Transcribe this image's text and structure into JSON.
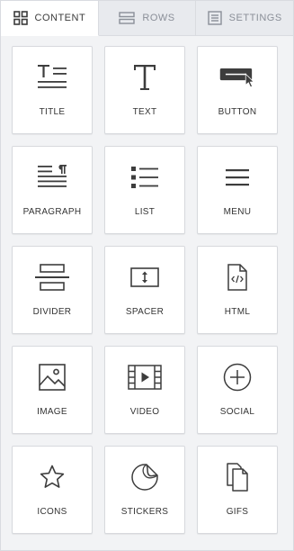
{
  "tabs": [
    {
      "label": "CONTENT",
      "icon": "grid-icon",
      "active": true
    },
    {
      "label": "ROWS",
      "icon": "rows-icon",
      "active": false
    },
    {
      "label": "SETTINGS",
      "icon": "settings-icon",
      "active": false
    }
  ],
  "tiles": [
    {
      "label": "TITLE",
      "icon": "title-icon"
    },
    {
      "label": "TEXT",
      "icon": "text-icon"
    },
    {
      "label": "BUTTON",
      "icon": "button-icon"
    },
    {
      "label": "PARAGRAPH",
      "icon": "paragraph-icon"
    },
    {
      "label": "LIST",
      "icon": "list-icon"
    },
    {
      "label": "MENU",
      "icon": "menu-icon"
    },
    {
      "label": "DIVIDER",
      "icon": "divider-icon"
    },
    {
      "label": "SPACER",
      "icon": "spacer-icon"
    },
    {
      "label": "HTML",
      "icon": "html-icon"
    },
    {
      "label": "IMAGE",
      "icon": "image-icon"
    },
    {
      "label": "VIDEO",
      "icon": "video-icon"
    },
    {
      "label": "SOCIAL",
      "icon": "social-icon"
    },
    {
      "label": "ICONS",
      "icon": "star-icon"
    },
    {
      "label": "STICKERS",
      "icon": "sticker-icon"
    },
    {
      "label": "GIFS",
      "icon": "gifs-icon"
    }
  ],
  "colors": {
    "icon": "#3d3d3d",
    "active_tab_text": "#3b3b3b",
    "inactive_tab_text": "#8a8f98"
  }
}
